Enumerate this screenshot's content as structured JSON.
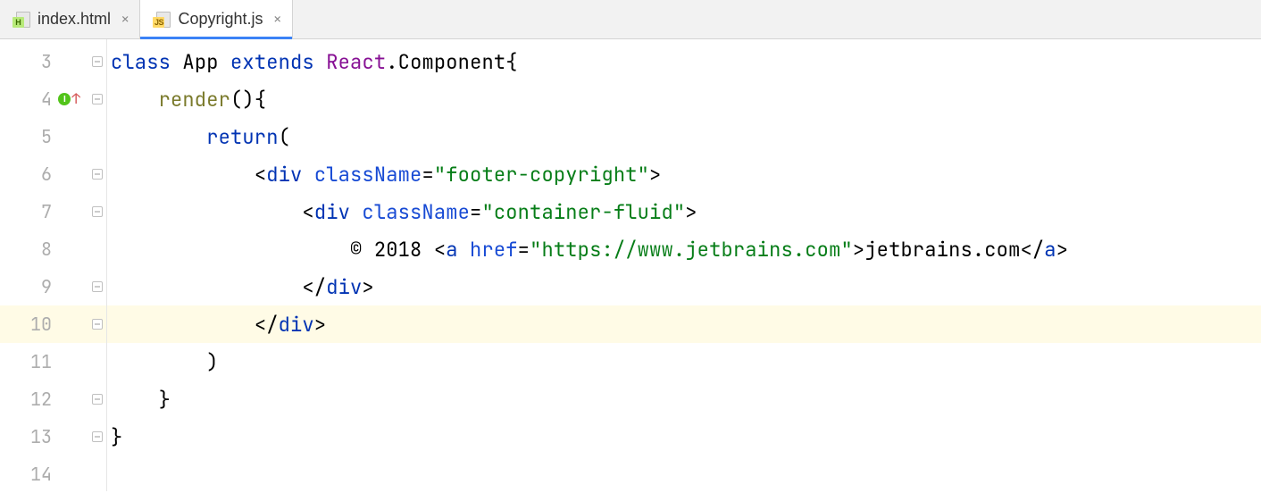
{
  "tabs": [
    {
      "label": "index.html",
      "icon_badge": "H",
      "active": false
    },
    {
      "label": "Copyright.js",
      "icon_badge": "JS",
      "active": true
    }
  ],
  "gutter": {
    "start": 3,
    "lines": [
      {
        "num": "3",
        "fold": "open",
        "mark": null
      },
      {
        "num": "4",
        "fold": "open",
        "mark": "i-up"
      },
      {
        "num": "5",
        "fold": null,
        "mark": null
      },
      {
        "num": "6",
        "fold": "open",
        "mark": null
      },
      {
        "num": "7",
        "fold": "open",
        "mark": null
      },
      {
        "num": "8",
        "fold": null,
        "mark": null
      },
      {
        "num": "9",
        "fold": "close",
        "mark": null
      },
      {
        "num": "10",
        "fold": "close",
        "mark": null,
        "highlight": true
      },
      {
        "num": "11",
        "fold": null,
        "mark": null
      },
      {
        "num": "12",
        "fold": "close",
        "mark": null
      },
      {
        "num": "13",
        "fold": "close",
        "mark": null
      },
      {
        "num": "14",
        "fold": null,
        "mark": null
      }
    ]
  },
  "code": {
    "l3": {
      "kw_class": "class",
      "name": " App ",
      "kw_ext": "extends",
      "sp": " ",
      "react": "React",
      "dot": ".",
      "comp": "Component",
      "brace": "{"
    },
    "l4": {
      "indent": "    ",
      "fn": "render",
      "rest": "(){"
    },
    "l5": {
      "indent": "        ",
      "kw": "return",
      "paren": "("
    },
    "l6": {
      "indent": "            ",
      "lt": "<",
      "tag": "div",
      "sp": " ",
      "attr": "className",
      "eq": "=",
      "str": "\"footer-copyright\"",
      "gt": ">"
    },
    "l7": {
      "indent": "                ",
      "lt": "<",
      "tag": "div",
      "sp": " ",
      "attr": "className",
      "eq": "=",
      "str": "\"container-fluid\"",
      "gt": ">"
    },
    "l8": {
      "indent": "                    ",
      "text1": "© 2018 ",
      "lt": "<",
      "tag": "a",
      "sp": " ",
      "attr": "href",
      "eq": "=",
      "str": "\"https://www.jetbrains.com\"",
      "gt": ">",
      "linktxt": "jetbrains.com",
      "lt2": "</",
      "tag2": "a",
      "gt2": ">"
    },
    "l9": {
      "indent": "                ",
      "lt": "</",
      "tag": "div",
      "gt": ">"
    },
    "l10": {
      "indent": "            ",
      "lt": "</",
      "tag": "div",
      "gt": ">"
    },
    "l11": {
      "indent": "        ",
      "paren": ")"
    },
    "l12": {
      "indent": "    ",
      "brace": "}"
    },
    "l13": {
      "brace": "}"
    }
  }
}
